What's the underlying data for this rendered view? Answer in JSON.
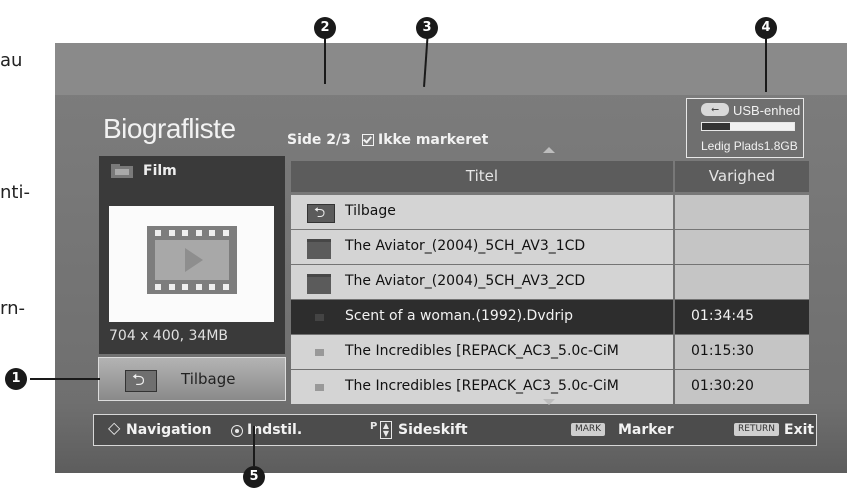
{
  "side_text": [
    "au",
    "nti-",
    "rn-"
  ],
  "title": "Biografliste",
  "page_indicator": "Side 2/3",
  "mark_status": "Ikke markeret",
  "usb": {
    "label": "USB-enhed",
    "icon": "usb-icon",
    "free": "Ledig Plads1.8GB",
    "used_fraction": 0.3
  },
  "film_panel": {
    "header": "Film",
    "info": "704 x 400, 34MB"
  },
  "back_button": "Tilbage",
  "table": {
    "headers": [
      "Titel",
      "Varighed"
    ],
    "rows": [
      {
        "type": "back",
        "name": "Tilbage",
        "duration": ""
      },
      {
        "type": "folder",
        "name": "The Aviator_(2004)_5CH_AV3_1CD",
        "duration": ""
      },
      {
        "type": "folder",
        "name": "The Aviator_(2004)_5CH_AV3_2CD",
        "duration": ""
      },
      {
        "type": "file",
        "name": "Scent of a woman.(1992).Dvdrip",
        "duration": "01:34:45",
        "selected": true
      },
      {
        "type": "file",
        "name": "The Incredibles [REPACK_AC3_5.0c-CiM",
        "duration": "01:15:30"
      },
      {
        "type": "file",
        "name": "The Incredibles [REPACK_AC3_5.0c-CiM",
        "duration": "01:30:20"
      }
    ]
  },
  "bottom_bar": {
    "navigation": "Navigation",
    "select": "Indstil.",
    "p_key": "P",
    "page_change": "Sideskift",
    "mark_key": "MARK",
    "mark": "Marker",
    "return_key": "RETURN",
    "exit": "Exit"
  },
  "callouts": [
    "1",
    "2",
    "3",
    "4",
    "5"
  ]
}
